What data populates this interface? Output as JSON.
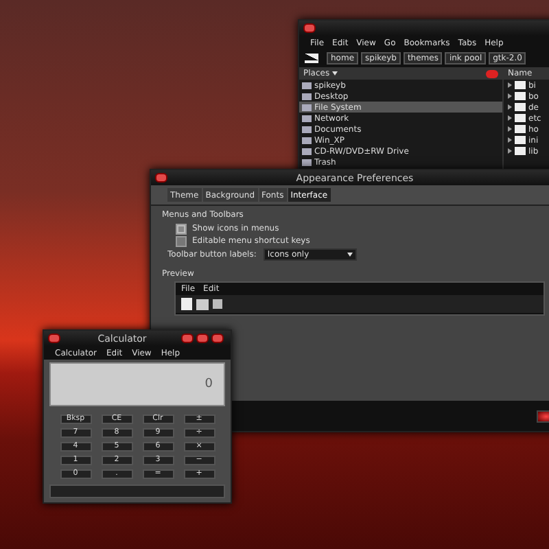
{
  "file_manager": {
    "menu": [
      "File",
      "Edit",
      "View",
      "Go",
      "Bookmarks",
      "Tabs",
      "Help"
    ],
    "path_buttons": [
      "home",
      "spikeyb",
      "themes",
      "ink pool",
      "gtk-2.0"
    ],
    "sidebar": {
      "header": "Places",
      "items": [
        {
          "label": "spikeyb",
          "selected": false
        },
        {
          "label": "Desktop",
          "selected": false
        },
        {
          "label": "File System",
          "selected": true
        },
        {
          "label": "Network",
          "selected": false
        },
        {
          "label": "Documents",
          "selected": false
        },
        {
          "label": "Win_XP",
          "selected": false
        },
        {
          "label": "CD-RW/DVD±RW Drive",
          "selected": false
        },
        {
          "label": "Trash",
          "selected": false
        }
      ]
    },
    "file_list": {
      "column": "Name",
      "items": [
        "bi",
        "bo",
        "de",
        "etc",
        "ho",
        "ini",
        "lib"
      ]
    }
  },
  "appearance": {
    "title": "Appearance Preferences",
    "tabs": [
      {
        "label": "Theme",
        "selected": false
      },
      {
        "label": "Background",
        "selected": false
      },
      {
        "label": "Fonts",
        "selected": false
      },
      {
        "label": "Interface",
        "selected": true
      }
    ],
    "section": "Menus and Toolbars",
    "options": [
      {
        "label": "Show icons in menus",
        "checked": true
      },
      {
        "label": "Editable menu shortcut keys",
        "checked": false
      }
    ],
    "toolbar_labels": {
      "label": "Toolbar button labels:",
      "value": "Icons only"
    },
    "preview": {
      "title": "Preview",
      "menu": [
        "File",
        "Edit"
      ]
    }
  },
  "calculator": {
    "title": "Calculator",
    "menu": [
      "Calculator",
      "Edit",
      "View",
      "Help"
    ],
    "display": "0",
    "keys": [
      "Bksp",
      "CE",
      "Clr",
      "±",
      "7",
      "8",
      "9",
      "÷",
      "4",
      "5",
      "6",
      "×",
      "1",
      "2",
      "3",
      "−",
      "0",
      ".",
      "=",
      "+"
    ]
  }
}
